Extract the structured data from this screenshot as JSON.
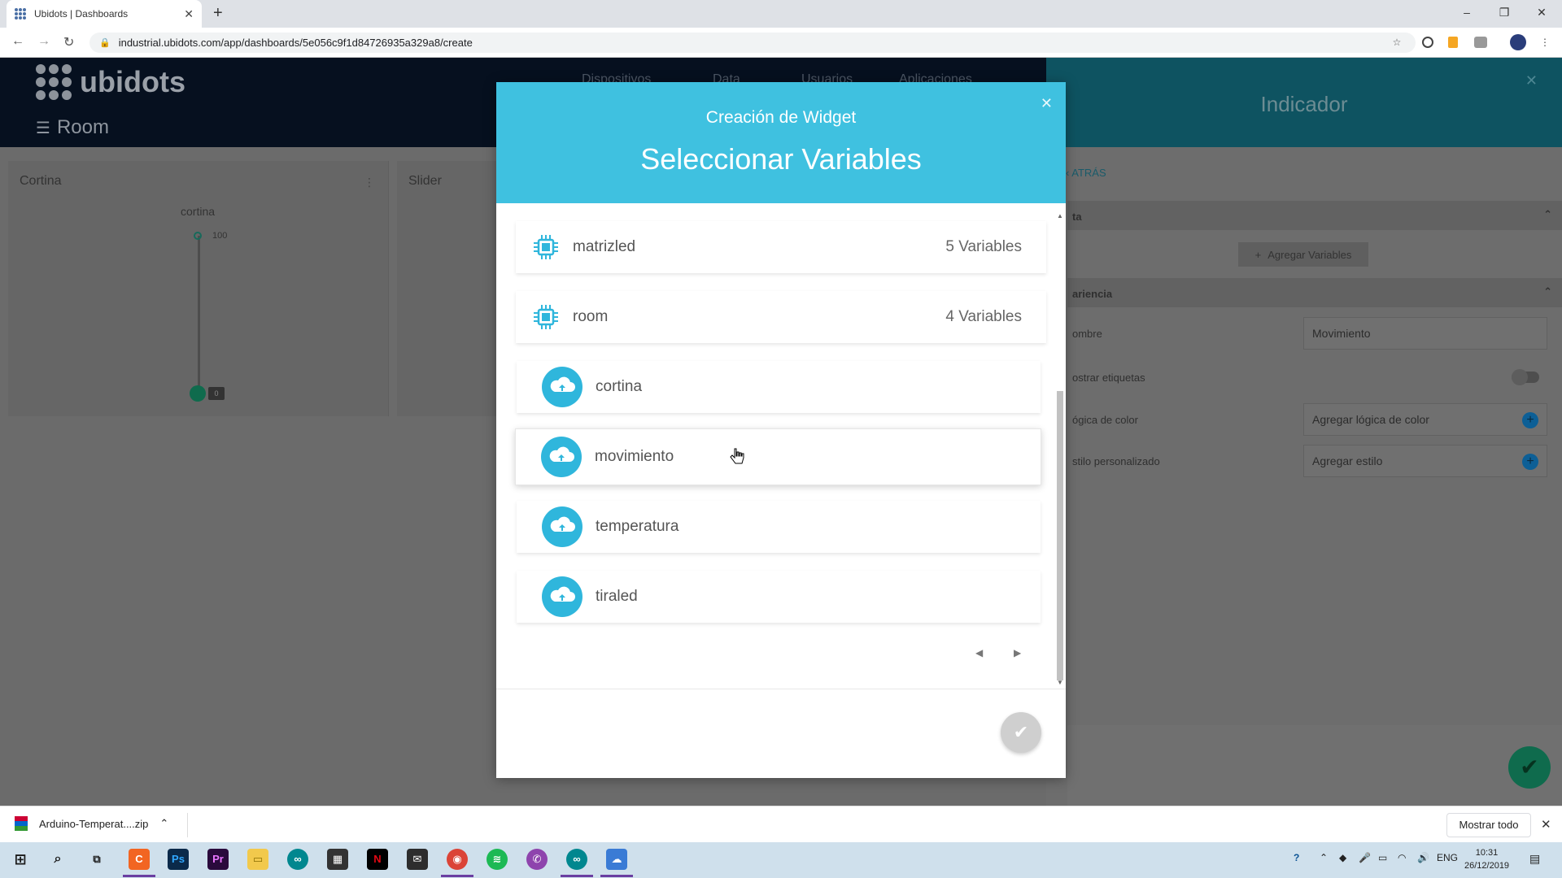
{
  "browser": {
    "tab_title": "Ubidots | Dashboards",
    "url": "industrial.ubidots.com/app/dashboards/5e056c9f1d84726935a329a8/create"
  },
  "app": {
    "brand": "ubidots",
    "nav": [
      "Dispositivos",
      "Data",
      "Usuarios",
      "Aplicaciones"
    ],
    "dashboard_title": "Room",
    "widgets": [
      {
        "title": "Cortina",
        "label": "cortina",
        "max": "100",
        "value": "0"
      },
      {
        "title": "Slider"
      }
    ]
  },
  "side_panel": {
    "title": "Indicador",
    "back": "ATRÁS",
    "section_data": "ta",
    "add_variables": "Agregar Variables",
    "section_appearance": "ariencia",
    "name_label": "ombre",
    "name_value": "Movimiento",
    "show_labels": "ostrar etiquetas",
    "color_logic_label": "ógica de color",
    "color_logic_value": "Agregar lógica de color",
    "custom_style_label": "stilo personalizado",
    "custom_style_value": "Agregar estilo"
  },
  "modal": {
    "subtitle": "Creación de Widget",
    "title": "Seleccionar Variables",
    "devices": [
      {
        "name": "matrizled",
        "count": "5 Variables"
      },
      {
        "name": "room",
        "count": "4 Variables"
      }
    ],
    "variables": [
      "cortina",
      "movimiento",
      "temperatura",
      "tiraled"
    ],
    "hovered_variable": "movimiento"
  },
  "download_bar": {
    "file": "Arduino-Temperat....zip",
    "show_all": "Mostrar todo"
  },
  "taskbar": {
    "lang": "ENG",
    "time": "10:31",
    "date": "26/12/2019"
  },
  "colors": {
    "modal_header": "#3fc1e0",
    "variable_icon": "#2fb6dc",
    "confirm_fab": "#0f6b4d"
  }
}
